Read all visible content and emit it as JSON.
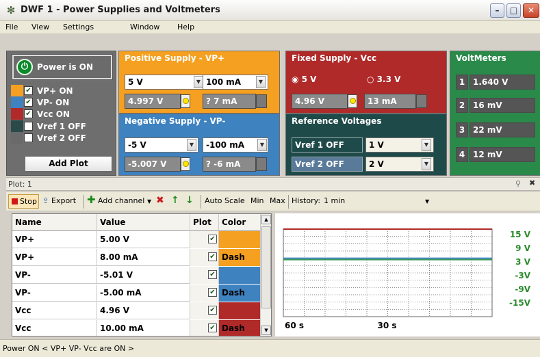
{
  "window": {
    "title": "DWF 1 - Power Supplies and Voltmeters"
  },
  "menu": [
    "File",
    "View",
    "Settings",
    "Window",
    "Help"
  ],
  "power": {
    "label": "Power is ON"
  },
  "channels": [
    {
      "label": "VP+ ON",
      "checked": true,
      "color": "#f5a020"
    },
    {
      "label": "VP-  ON",
      "checked": true,
      "color": "#3e82c0"
    },
    {
      "label": "Vcc  ON",
      "checked": true,
      "color": "#b02a2a"
    },
    {
      "label": "Vref 1  OFF",
      "checked": false,
      "color": "#2a4a4a"
    },
    {
      "label": "Vref 2  OFF",
      "checked": false,
      "color": "#6a6a6a"
    }
  ],
  "add_plot_label": "Add Plot",
  "positive_supply": {
    "title": "Positive Supply - VP+",
    "voltage_select": "5 V",
    "current_select": "100 mA",
    "voltage_reading": "4.997 V",
    "current_reading": "? 7 mA"
  },
  "negative_supply": {
    "title": "Negative Supply - VP-",
    "voltage_select": "-5 V",
    "current_select": "-100 mA",
    "voltage_reading": "-5.007 V",
    "current_reading": "? -6 mA"
  },
  "fixed_supply": {
    "title": "Fixed Supply - Vcc",
    "option_5v": "5 V",
    "option_33v": "3.3 V",
    "voltage_reading": "4.96 V",
    "current_reading": "13 mA"
  },
  "reference": {
    "title": "Reference Voltages",
    "vref1_label": "Vref 1  OFF",
    "vref1_value": "1 V",
    "vref2_label": "Vref 2  OFF",
    "vref2_value": "2 V"
  },
  "voltmeters": {
    "title": "VoltMeters",
    "meters": [
      {
        "index": "1",
        "value": "1.640 V"
      },
      {
        "index": "2",
        "value": "16 mV"
      },
      {
        "index": "3",
        "value": "22 mV"
      },
      {
        "index": "4",
        "value": "12 mV"
      }
    ]
  },
  "plot": {
    "title": "Plot: 1"
  },
  "toolbar": {
    "stop": "Stop",
    "export": "Export",
    "add_channel": "Add channel",
    "auto_scale": "Auto Scale",
    "min": "Min",
    "max": "Max",
    "history_label": "History:",
    "history_value": "1 min"
  },
  "grid": {
    "headers": [
      "Name",
      "Value",
      "Plot",
      "Color"
    ],
    "rows": [
      {
        "name": "VP+",
        "value": "5.00 V",
        "plot": true,
        "color": "#f5a020",
        "style": ""
      },
      {
        "name": "VP+",
        "value": "8.00 mA",
        "plot": true,
        "color": "#f5a020",
        "style": "Dash"
      },
      {
        "name": "VP-",
        "value": "-5.01 V",
        "plot": true,
        "color": "#3e82c0",
        "style": ""
      },
      {
        "name": "VP-",
        "value": "-5.00 mA",
        "plot": true,
        "color": "#3e82c0",
        "style": "Dash"
      },
      {
        "name": "Vcc",
        "value": "4.96 V",
        "plot": true,
        "color": "#b02a2a",
        "style": ""
      },
      {
        "name": "Vcc",
        "value": "10.00 mA",
        "plot": true,
        "color": "#b02a2a",
        "style": "Dash"
      }
    ]
  },
  "chart_data": {
    "type": "line",
    "x_tick_labels": [
      "60 s",
      "30 s"
    ],
    "y_tick_labels": [
      "15 V",
      "9 V",
      "3 V",
      "-3V",
      "-9V",
      "-15V"
    ],
    "ylim": [
      -15,
      15
    ],
    "grid": true,
    "label_color": "#2a8a2a",
    "series": [
      {
        "color": "#3e82c0",
        "values": [
          5.0,
          5.0
        ]
      },
      {
        "color": "#3a9a5a",
        "values": [
          5.0,
          5.0
        ]
      }
    ]
  },
  "status": {
    "text": "Power ON < VP+ VP- Vcc are ON >"
  }
}
